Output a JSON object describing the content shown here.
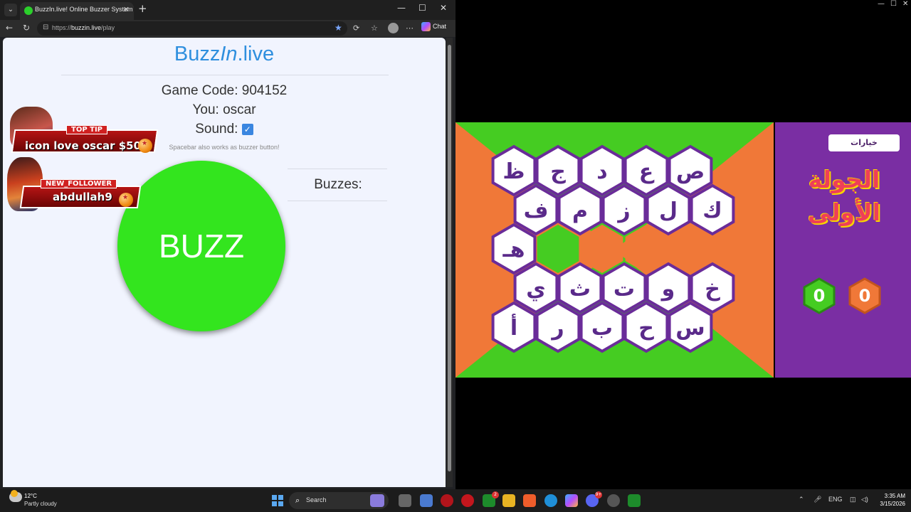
{
  "browser": {
    "tab_title": "BuzzIn.live! Online Buzzer System",
    "url_scheme": "https://",
    "url_host": "buzzin.live",
    "url_path": "/play",
    "chat_label": "Chat"
  },
  "page": {
    "logo_part1": "Buzz",
    "logo_part2": "In",
    "logo_part3": ".live",
    "game_code_label": "Game Code:",
    "game_code": "904152",
    "you_label": "You:",
    "you_name": "oscar",
    "sound_label": "Sound:",
    "sound_checked": true,
    "hint": "Spacebar also works as buzzer button!",
    "buzzes_label": "Buzzes:",
    "buzz_button": "BUZZ"
  },
  "overlays": {
    "top_tip_tag": "TOP TIP",
    "top_tip_message": "icon love oscar $50",
    "follower_tag": "NEW_FOLLOWER",
    "follower_name": "abdullah9"
  },
  "game": {
    "options_button": "خيارات",
    "round_title_line1": "الجولة",
    "round_title_line2": "الأولى",
    "score_green": "0",
    "score_orange": "0",
    "colors": {
      "green": "#45cc22",
      "orange": "#f07838",
      "purple": "#7a2ea3",
      "hex_border": "#6a2c99",
      "letter": "#5a2a8a"
    },
    "rows": [
      [
        "ظ",
        "ج",
        "د",
        "ع",
        "ص"
      ],
      [
        "ف",
        "م",
        "ز",
        "ل",
        "ك"
      ],
      [
        "هـ",
        "",
        "",
        "",
        ""
      ],
      [
        "ي",
        "ث",
        "ت",
        "و",
        "خ"
      ],
      [
        "أ",
        "ر",
        "ب",
        "ح",
        "س"
      ]
    ],
    "empty_cell_colors": [
      "green",
      "orange",
      "orange",
      "orange"
    ]
  },
  "taskbar": {
    "temperature": "12°C",
    "condition": "Partly cloudy",
    "search_label": "Search",
    "language": "ENG",
    "time": "3:35 AM",
    "date": "3/15/2026",
    "badge_xbox": "2",
    "badge_discord": "9+"
  }
}
